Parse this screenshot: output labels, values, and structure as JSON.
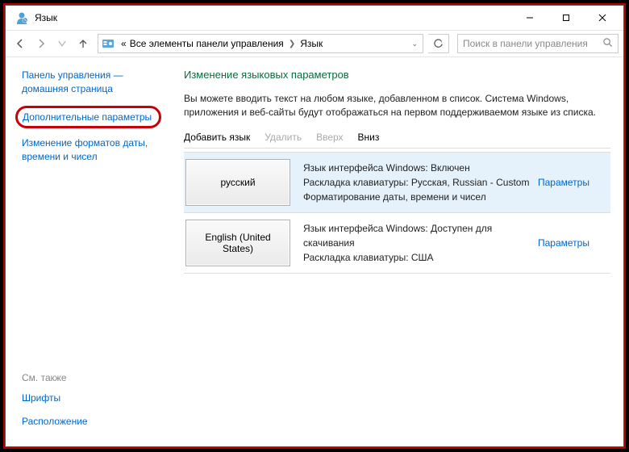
{
  "title": "Язык",
  "breadcrumb": {
    "prefix": "«",
    "item1": "Все элементы панели управления",
    "item2": "Язык"
  },
  "search": {
    "placeholder": "Поиск в панели управления"
  },
  "sidebar": {
    "home": "Панель управления — домашняя страница",
    "advanced": "Дополнительные параметры",
    "formats": "Изменение форматов даты, времени и чисел",
    "see_also": "См. также",
    "fonts": "Шрифты",
    "location": "Расположение"
  },
  "content": {
    "heading": "Изменение языковых параметров",
    "desc": "Вы можете вводить текст на любом языке, добавленном в список. Система Windows, приложения и веб-сайты будут отображаться на первом поддерживаемом языке из списка.",
    "cmd_add": "Добавить язык",
    "cmd_remove": "Удалить",
    "cmd_up": "Вверх",
    "cmd_down": "Вниз"
  },
  "langs": [
    {
      "name": "русский",
      "line1": "Язык интерфейса Windows: Включен",
      "line2": "Раскладка клавиатуры: Русская, Russian - Custom",
      "line3": "Форматирование даты, времени и чисел",
      "options": "Параметры",
      "selected": true
    },
    {
      "name": "English (United States)",
      "line1": "Язык интерфейса Windows: Доступен для скачивания",
      "line2": "Раскладка клавиатуры: США",
      "line3": "",
      "options": "Параметры",
      "selected": false
    }
  ]
}
